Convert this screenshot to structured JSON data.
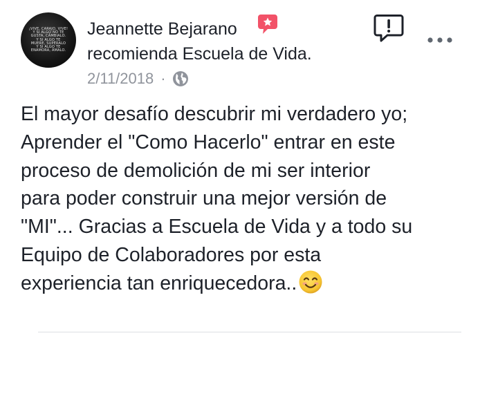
{
  "post": {
    "author": "Jeannette Bejarano",
    "recommends_text": "recomienda Escuela de Vida.",
    "date": "2/11/2018",
    "separator": "·",
    "privacy_icon": "globe-icon",
    "badge_icon": "recommend-star-icon",
    "avatar_text_lines": [
      "¡VIVE, CARAJO, VIVE!",
      "Y SI ALGO NO TE",
      "GUSTA, CÁMBIALO.",
      "Y SI ALGO TE",
      "MUERE, SUPÉRALO",
      "Y SI ALGO TE",
      "ENAMORA, ÁMALO."
    ],
    "body_lines": [
      "El mayor desafío descubrir mi verdadero yo;",
      "Aprender el \"Como Hacerlo\" entrar en este",
      "proceso de demolición de mi ser interior",
      "para poder construir una mejor versión de",
      "\"MI\"... Gracias a Escuela de Vida y a todo su",
      "Equipo de Colaboradores por esta",
      "experiencia tan enriquecedora.."
    ],
    "trailing_emoji": "smiling-face-icon"
  },
  "actions": {
    "report_icon": "report-icon",
    "more_icon": "more-options-icon"
  },
  "colors": {
    "text": "#1d2129",
    "meta": "#90949c",
    "badge": "#f25268",
    "divider": "#dddfe2"
  }
}
